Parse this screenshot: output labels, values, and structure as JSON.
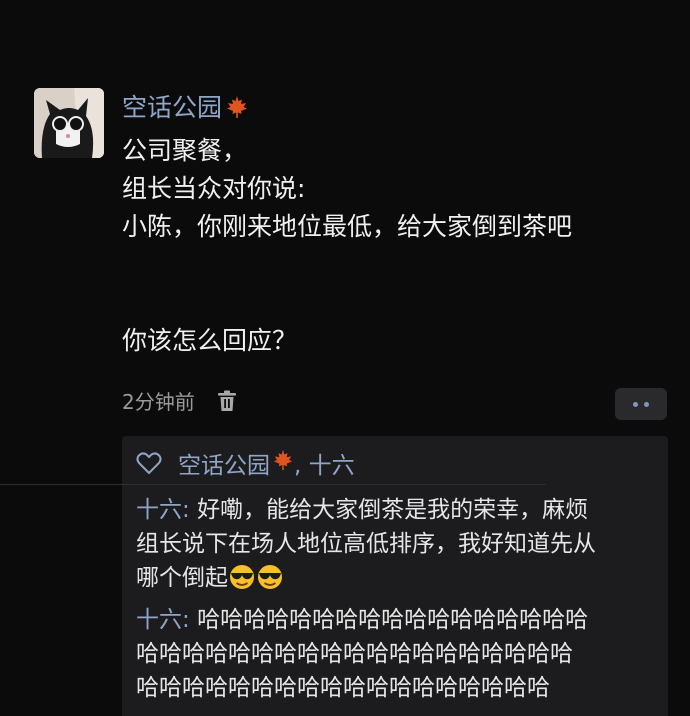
{
  "post": {
    "username": "空话公园",
    "lines": [
      "公司聚餐，",
      "组长当众对你说:",
      "小陈，你刚来地位最低，给大家倒到茶吧"
    ],
    "question": "你该怎么回应？",
    "time": "2分钟前"
  },
  "reply_panel": {
    "likes_text": ", 十六",
    "liker_name": "空话公园",
    "comments": [
      {
        "author": "十六",
        "separator": ": ",
        "lines": [
          "好嘞，能给大家倒茶是我的荣幸，麻烦",
          "组长说下在场人地位高低排序，我好知道先从",
          "哪个倒起"
        ],
        "emoji": "sunglasses-emoji"
      },
      {
        "author": "十六",
        "separator": ": ",
        "lines": [
          "哈哈哈哈哈哈哈哈哈哈哈哈哈哈哈哈哈",
          "哈哈哈哈哈哈哈哈哈哈哈哈哈哈哈哈哈哈哈",
          "哈哈哈哈哈哈哈哈哈哈哈哈哈哈哈哈哈哈"
        ]
      }
    ]
  },
  "colors": {
    "background": "#0b0b0b",
    "name_blue": "#8fa6c8",
    "panel": "#1c1c1e",
    "leaf": "#e0541f"
  },
  "icons": [
    "maple-leaf-icon",
    "trash-icon",
    "more-icon",
    "heart-icon",
    "sunglasses-emoji"
  ]
}
